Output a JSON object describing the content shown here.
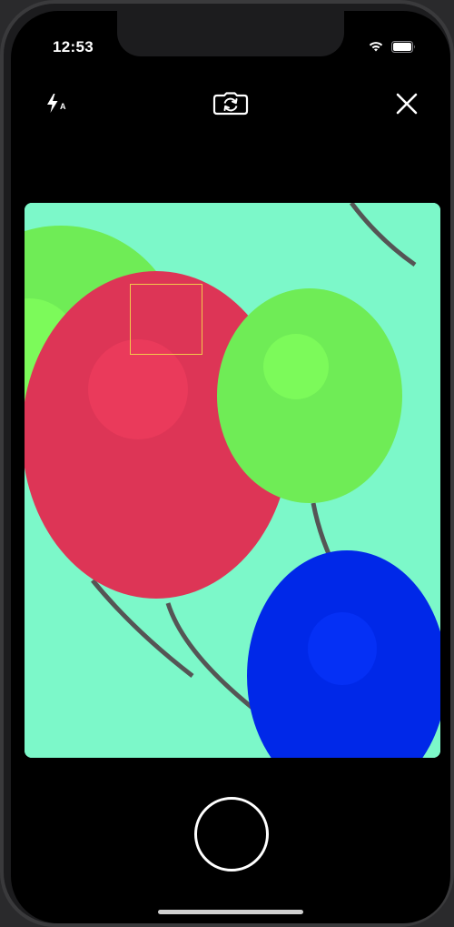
{
  "status_bar": {
    "time": "12:53",
    "wifi_icon": "wifi-icon",
    "battery_icon": "battery-icon"
  },
  "camera_toolbar": {
    "flash_icon": "flash-auto-icon",
    "flash_mode": "A",
    "switch_camera_icon": "camera-rotate-icon",
    "close_icon": "close-icon"
  },
  "viewfinder": {
    "background_color": "#7cf8c9",
    "balloon_colors": [
      "#6fec56",
      "#dd3556",
      "#0028e8"
    ],
    "string_color": "#555555",
    "focus_box_color": "#f2c94c"
  },
  "capture": {
    "shutter_icon": "shutter-button"
  }
}
